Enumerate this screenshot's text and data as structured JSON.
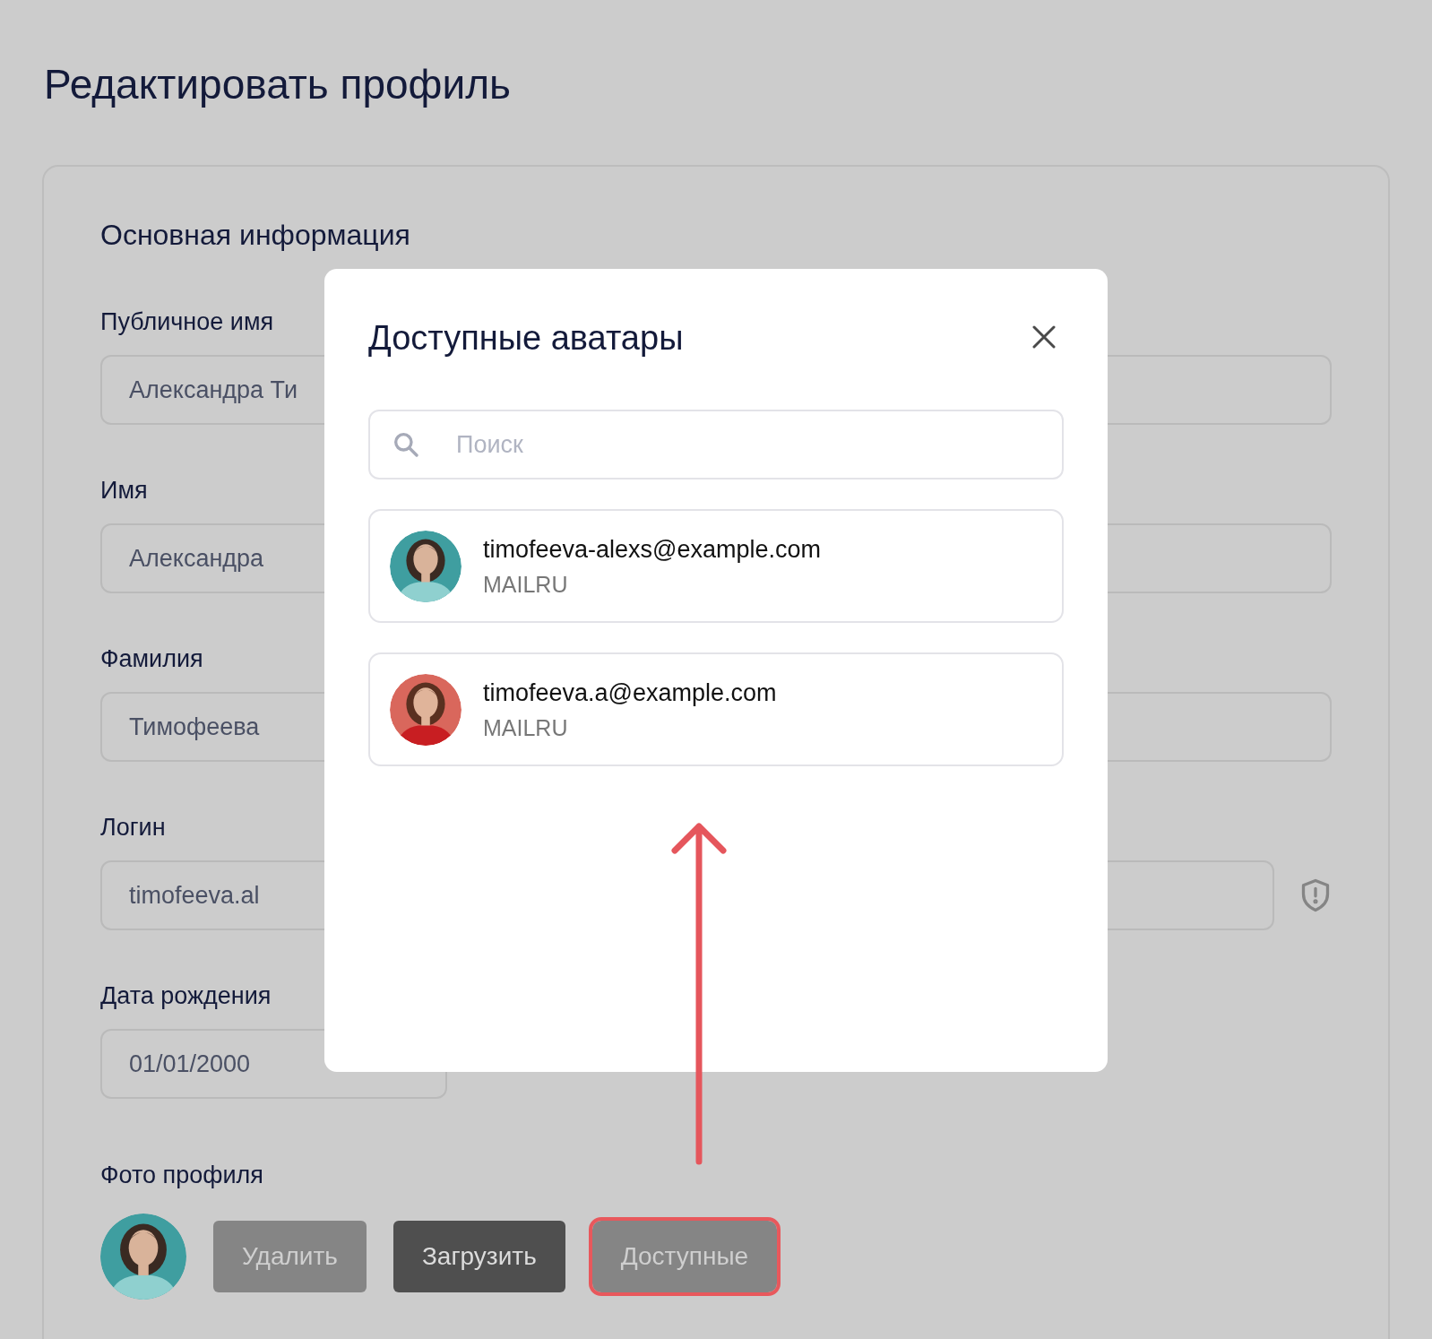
{
  "page_title": "Редактировать профиль",
  "section_title": "Основная информация",
  "fields": [
    {
      "label": "Публичное имя",
      "value": "Александра Ти",
      "kind": "text"
    },
    {
      "label": "Имя",
      "value": "Александра",
      "kind": "text"
    },
    {
      "label": "Фамилия",
      "value": "Тимофеева",
      "kind": "text"
    },
    {
      "label": "Логин",
      "value": "timofeeva.al",
      "kind": "secured"
    },
    {
      "label": "Дата рождения",
      "value": "01/01/2000",
      "kind": "date"
    }
  ],
  "photo": {
    "label": "Фото профиля",
    "buttons": [
      {
        "label": "Удалить",
        "kind": "secondary",
        "highlighted": false
      },
      {
        "label": "Загрузить",
        "kind": "primary",
        "highlighted": false
      },
      {
        "label": "Доступные",
        "kind": "secondary",
        "highlighted": true
      }
    ]
  },
  "dialog": {
    "title": "Доступные аватары",
    "search": {
      "placeholder": "Поиск"
    },
    "avatars": [
      {
        "email": "timofeeva-alexs@example.com",
        "source": "MAILRU"
      },
      {
        "email": "timofeeva.a@example.com",
        "source": "MAILRU"
      }
    ]
  }
}
